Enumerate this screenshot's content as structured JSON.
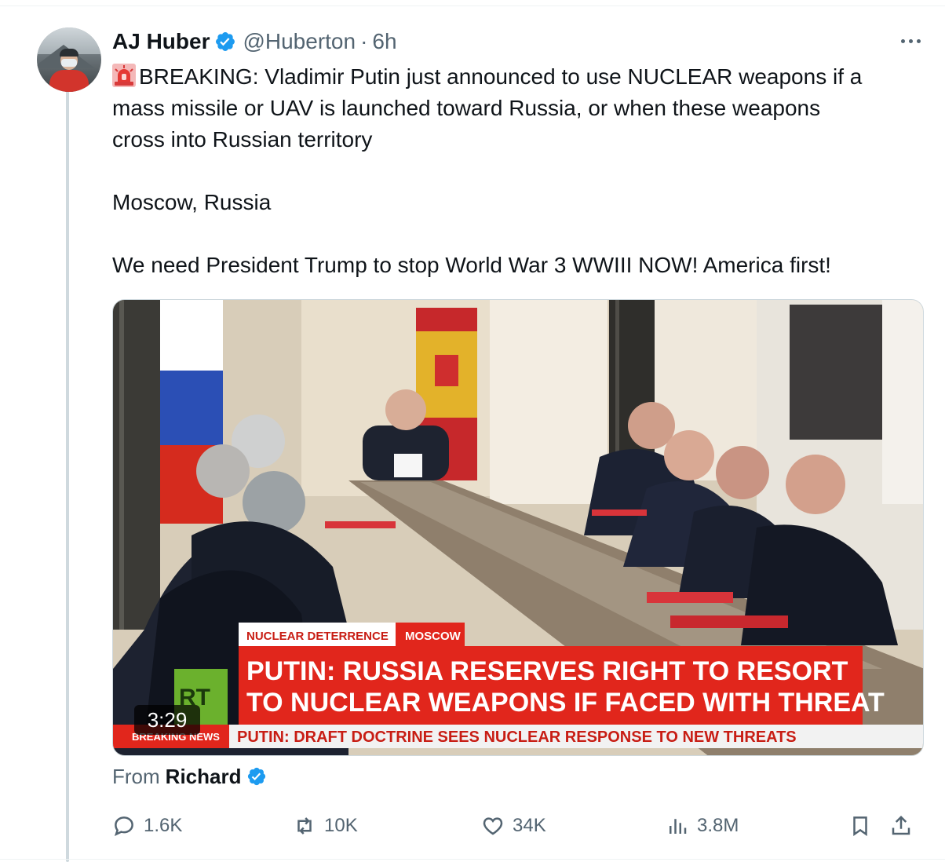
{
  "author": {
    "name": "AJ Huber",
    "handle": "@Huberton",
    "separator": "·",
    "time": "6h",
    "verified": true
  },
  "tweet": {
    "lines": [
      "BREAKING: Vladimir Putin just announced to use NUCLEAR weapons if a",
      "mass missile or UAV is launched toward Russia, or when these weapons",
      "cross into Russian territory",
      "Moscow, Russia",
      "We need President Trump to stop World War 3 WWIII NOW! America first!"
    ],
    "emoji": "siren-icon"
  },
  "media": {
    "duration": "3:29",
    "chyron": {
      "tag1": "NUCLEAR DETERRENCE",
      "tag2": "MOSCOW",
      "headline1": "PUTIN: RUSSIA RESERVES RIGHT TO RESORT",
      "headline2": "TO NUCLEAR WEAPONS IF FACED WITH THREAT",
      "ticker_label": "BREAKING NEWS",
      "ticker": "PUTIN: DRAFT DOCTRINE SEES NUCLEAR RESPONSE TO NEW THREATS",
      "logo": "RT"
    }
  },
  "attribution": {
    "prefix": "From",
    "source": "Richard",
    "verified": true
  },
  "actions": {
    "replies": "1.6K",
    "reposts": "10K",
    "likes": "34K",
    "views": "3.8M"
  },
  "colors": {
    "verified_blue": "#1d9bf0",
    "text_primary": "#0f1419",
    "text_secondary": "#536471",
    "thread_line": "#cfd9de",
    "chyron_red": "#e1261c"
  }
}
